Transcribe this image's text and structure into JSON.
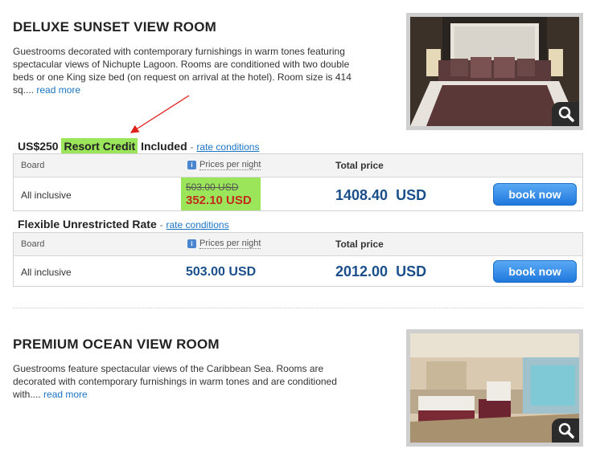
{
  "rooms": [
    {
      "title": "DELUXE SUNSET VIEW ROOM",
      "desc_line1": "Guestrooms decorated with contemporary furnishings in warm tones featuring",
      "desc_line2": "spectacular views of Nichupte Lagoon. Rooms are conditioned with two double",
      "desc_line3": "beds or one King size bed (on request on arrival at the hotel). Room size is 414",
      "desc_line4": "sq....",
      "read_more": "read more",
      "rates": [
        {
          "prefix": "US$250",
          "highlight": "Resort Credit",
          "suffix": "Included",
          "dash": "-",
          "conditions": "rate conditions",
          "col_board": "Board",
          "col_prices": "Prices per night",
          "col_total": "Total price",
          "board": "All inclusive",
          "old_price": "503.00 USD",
          "new_price": "352.10 USD",
          "total": "1408.40  USD",
          "book": "book now"
        },
        {
          "title": "Flexible Unrestricted Rate",
          "dash": "-",
          "conditions": "rate conditions",
          "col_board": "Board",
          "col_prices": "Prices per night",
          "col_total": "Total price",
          "board": "All inclusive",
          "price": "503.00 USD",
          "total": "2012.00  USD",
          "book": "book now"
        }
      ]
    },
    {
      "title": "PREMIUM OCEAN VIEW ROOM",
      "desc_line1": "Guestrooms feature spectacular views of the Caribbean Sea. Rooms are",
      "desc_line2": "decorated with contemporary furnishings in warm tones and are conditioned",
      "desc_line3": "with....",
      "read_more": "read more"
    }
  ],
  "info_icon": "i",
  "colors": {
    "highlight": "#9be55a",
    "annotation_arrow": "#e0201a",
    "price_blue": "#1b4f8b",
    "discount_red": "#c22b1d",
    "button_blue": "#1e78dc",
    "link_blue": "#1a74c5"
  },
  "icons": [
    "zoom-icon",
    "info-icon",
    "annotation-arrow"
  ]
}
